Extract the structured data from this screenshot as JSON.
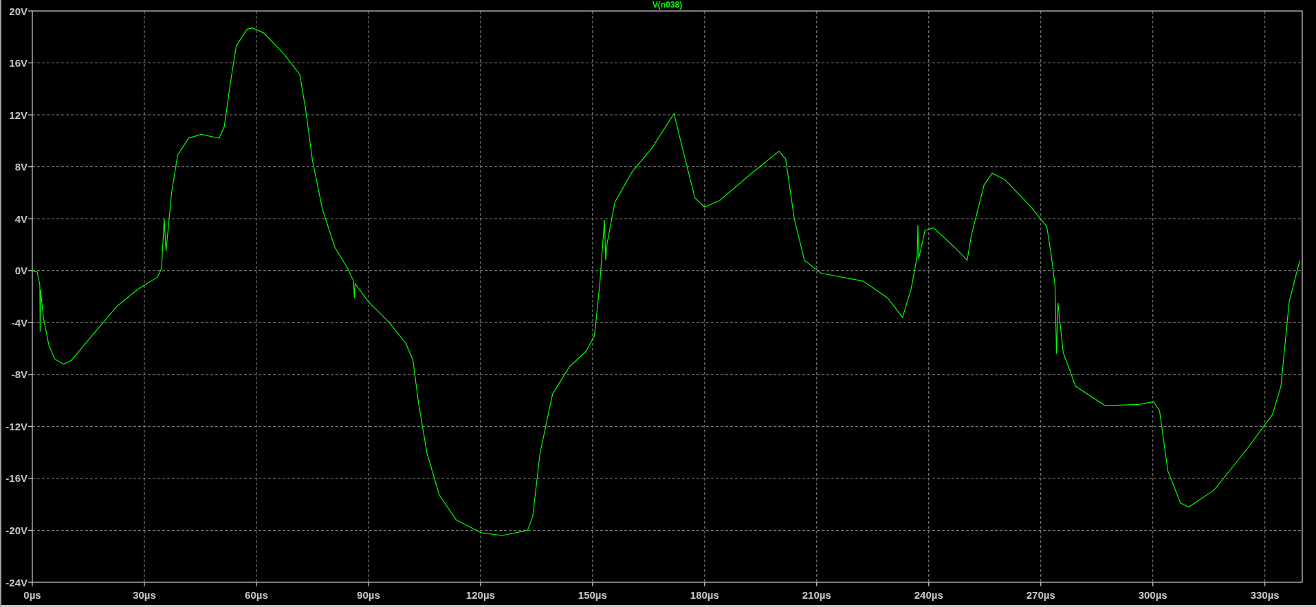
{
  "chart_data": {
    "type": "line",
    "grid": true,
    "xlim": [
      0,
      340
    ],
    "ylim": [
      -24,
      20
    ],
    "xticks": [
      {
        "value": 0,
        "label": "0µs"
      },
      {
        "value": 30,
        "label": "30µs"
      },
      {
        "value": 60,
        "label": "60µs"
      },
      {
        "value": 90,
        "label": "90µs"
      },
      {
        "value": 120,
        "label": "120µs"
      },
      {
        "value": 150,
        "label": "150µs"
      },
      {
        "value": 180,
        "label": "180µs"
      },
      {
        "value": 210,
        "label": "210µs"
      },
      {
        "value": 240,
        "label": "240µs"
      },
      {
        "value": 270,
        "label": "270µs"
      },
      {
        "value": 300,
        "label": "300µs"
      },
      {
        "value": 330,
        "label": "330µs"
      }
    ],
    "yticks": [
      {
        "value": 20,
        "label": "20V"
      },
      {
        "value": 16,
        "label": "16V"
      },
      {
        "value": 12,
        "label": "12V"
      },
      {
        "value": 8,
        "label": "8V"
      },
      {
        "value": 4,
        "label": "4V"
      },
      {
        "value": 0,
        "label": "0V"
      },
      {
        "value": -4,
        "label": "-4V"
      },
      {
        "value": -8,
        "label": "-8V"
      },
      {
        "value": -12,
        "label": "-12V"
      },
      {
        "value": -16,
        "label": "-16V"
      },
      {
        "value": -20,
        "label": "-20V"
      },
      {
        "value": -24,
        "label": "-24V"
      }
    ],
    "x": [
      0,
      1.3,
      2,
      2.1,
      2.2,
      3,
      4.4,
      6,
      8.3,
      10.5,
      16,
      22.8,
      28.4,
      33.5,
      34.6,
      35.3,
      35.8,
      37.3,
      38.9,
      41.8,
      45.2,
      50,
      51.4,
      53,
      54.6,
      57.5,
      59,
      62,
      67.6,
      71.6,
      73.2,
      75,
      77.7,
      81,
      84.4,
      86,
      86.2,
      86.4,
      90,
      95.6,
      100,
      101.9,
      103.4,
      105.7,
      109,
      113.5,
      120.2,
      125.8,
      132.6,
      134,
      135.9,
      139.3,
      143.8,
      148.3,
      150.5,
      151.9,
      153.2,
      153.5,
      153.9,
      156,
      160.6,
      166,
      171.8,
      174,
      177.4,
      180,
      184,
      193,
      199.9,
      201.7,
      204,
      206.7,
      211.2,
      222.4,
      229,
      233,
      235.3,
      236.9,
      237.1,
      237.3,
      239,
      241.3,
      246.9,
      250.3,
      251.4,
      254.8,
      257,
      260.4,
      267.1,
      271.6,
      272.7,
      273.8,
      274.2,
      274.6,
      276,
      279.3,
      287.2,
      296.2,
      300.2,
      301.8,
      304,
      307.4,
      309.6,
      316.4,
      325.3,
      332,
      334.3,
      336.5,
      338.8,
      339.4
    ],
    "series": [
      {
        "name": "V(n038)",
        "color": "#00ff00",
        "values": [
          0,
          -0.1,
          -1.1,
          -4.7,
          -1.5,
          -3.7,
          -5.7,
          -6.8,
          -7.2,
          -6.9,
          -5,
          -2.7,
          -1.4,
          -0.5,
          0.2,
          4,
          1.5,
          6,
          8.9,
          10.2,
          10.5,
          10.2,
          11.1,
          14.4,
          17.3,
          18.6,
          18.7,
          18.3,
          16.6,
          15.1,
          12.4,
          8.5,
          4.7,
          1.8,
          0.2,
          -0.8,
          -2.1,
          -1,
          -2.4,
          -4,
          -5.6,
          -6.9,
          -10.2,
          -14.1,
          -17.3,
          -19.2,
          -20.2,
          -20.4,
          -20,
          -18.9,
          -14.1,
          -9.5,
          -7.4,
          -6.2,
          -5,
          -1.1,
          3.9,
          0.8,
          2.1,
          5.3,
          7.6,
          9.5,
          12.1,
          9.5,
          5.6,
          4.9,
          5.4,
          7.6,
          9.2,
          8.6,
          4,
          0.8,
          -0.2,
          -0.8,
          -2.1,
          -3.6,
          -1.4,
          1.1,
          3.5,
          0.9,
          3.1,
          3.3,
          1.8,
          0.8,
          2.7,
          6.6,
          7.5,
          7,
          5,
          3.4,
          1.4,
          -1.1,
          -6.4,
          -2.5,
          -6.3,
          -8.9,
          -10.4,
          -10.3,
          -10.1,
          -10.8,
          -15.4,
          -17.9,
          -18.2,
          -16.9,
          -13.7,
          -11.1,
          -8.9,
          -2.4,
          0.2,
          0.8
        ]
      }
    ]
  }
}
